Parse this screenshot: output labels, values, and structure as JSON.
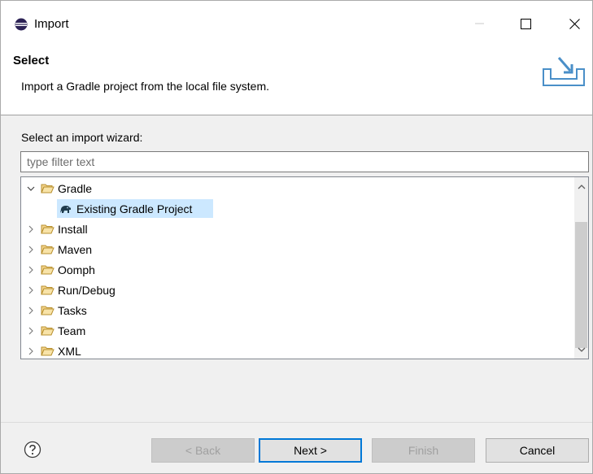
{
  "window": {
    "title": "Import"
  },
  "header": {
    "title": "Select",
    "description": "Import a Gradle project from the local file system."
  },
  "wizard": {
    "label": "Select an import wizard:",
    "filter_placeholder": "type filter text",
    "filter_value": ""
  },
  "tree": {
    "items": [
      {
        "label": "Gradle",
        "expanded": true,
        "icon": "folder-open-icon"
      },
      {
        "label": "Existing Gradle Project",
        "selected": true,
        "icon": "gradle-elephant-icon"
      },
      {
        "label": "Install",
        "expanded": false,
        "icon": "folder-open-icon"
      },
      {
        "label": "Maven",
        "expanded": false,
        "icon": "folder-open-icon"
      },
      {
        "label": "Oomph",
        "expanded": false,
        "icon": "folder-open-icon"
      },
      {
        "label": "Run/Debug",
        "expanded": false,
        "icon": "folder-open-icon"
      },
      {
        "label": "Tasks",
        "expanded": false,
        "icon": "folder-open-icon"
      },
      {
        "label": "Team",
        "expanded": false,
        "icon": "folder-open-icon"
      },
      {
        "label": "XML",
        "expanded": false,
        "icon": "folder-open-icon"
      }
    ]
  },
  "buttons": {
    "back": "< Back",
    "next": "Next >",
    "finish": "Finish",
    "cancel": "Cancel"
  },
  "colors": {
    "selection": "#cce8ff",
    "default_button_border": "#0078d7",
    "folder": "#dcb35c"
  }
}
